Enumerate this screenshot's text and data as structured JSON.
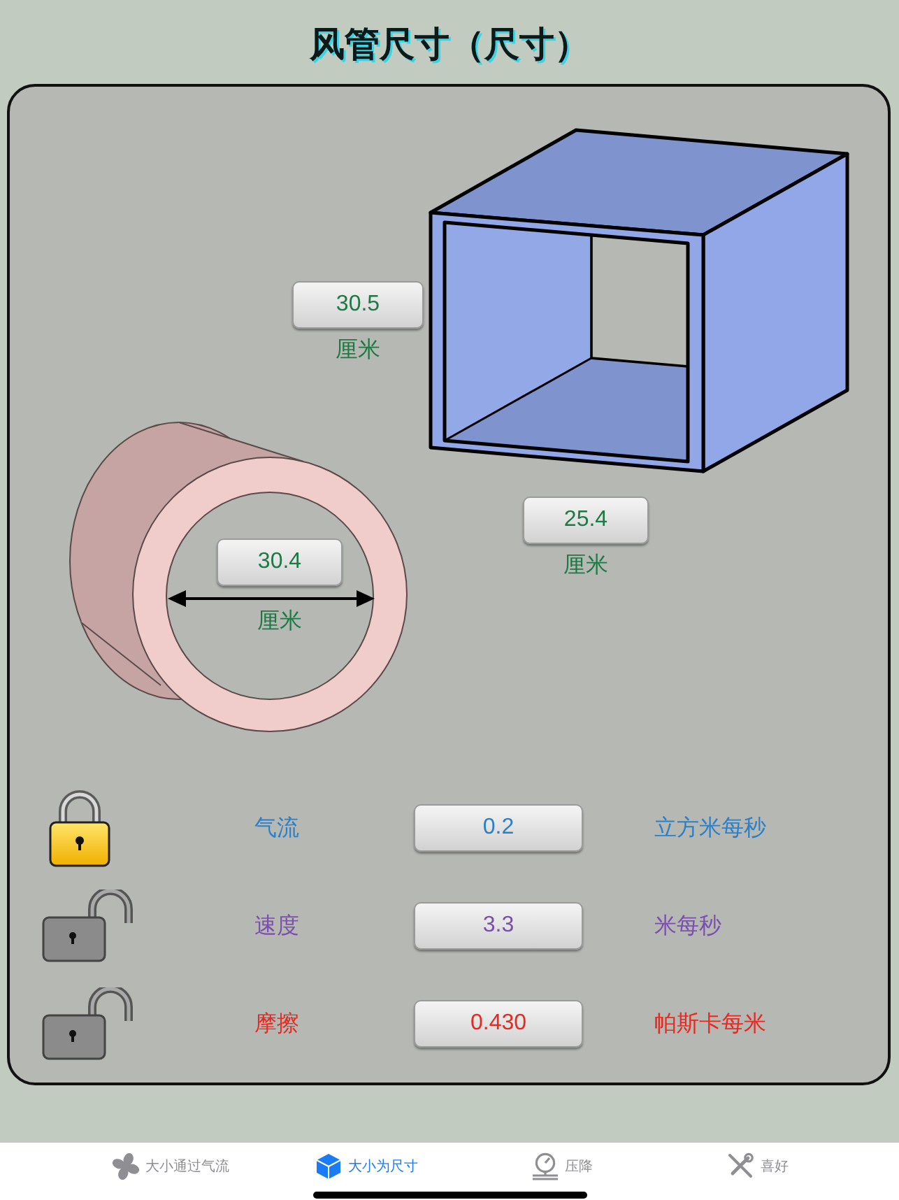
{
  "title": "风管尺寸（尺寸）",
  "rectangular_duct": {
    "height": {
      "value": "30.5",
      "unit": "厘米"
    },
    "width": {
      "value": "25.4",
      "unit": "厘米"
    }
  },
  "round_duct": {
    "diameter": {
      "value": "30.4",
      "unit": "厘米"
    }
  },
  "parameters": [
    {
      "label": "气流",
      "value": "0.2",
      "unit": "立方米每秒",
      "locked": true,
      "color": "#2e7fc6"
    },
    {
      "label": "速度",
      "value": "3.3",
      "unit": "米每秒",
      "locked": false,
      "color": "#7b4fae"
    },
    {
      "label": "摩擦",
      "value": "0.430",
      "unit": "帕斯卡每米",
      "locked": false,
      "color": "#e62a22"
    }
  ],
  "tab_bar": [
    {
      "label": "大小通过气流",
      "selected": false
    },
    {
      "label": "大小为尺寸",
      "selected": true
    },
    {
      "label": "压降",
      "selected": false
    },
    {
      "label": "喜好",
      "selected": false
    }
  ]
}
